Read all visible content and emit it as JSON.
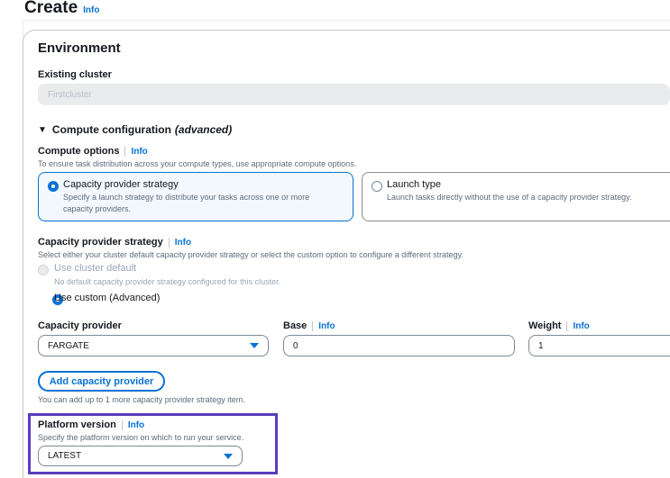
{
  "header": {
    "title": "Create",
    "info": "Info"
  },
  "environment": {
    "heading": "Environment",
    "existing_cluster_label": "Existing cluster",
    "existing_cluster_value": "Firstcluster"
  },
  "compute": {
    "expander_label": "Compute configuration",
    "expander_suffix": "(advanced)",
    "options_label": "Compute options",
    "options_info": "Info",
    "options_desc": "To ensure task distribution across your compute types, use appropriate compute options.",
    "tile_capacity_title": "Capacity provider strategy",
    "tile_capacity_desc": "Specify a launch strategy to distribute your tasks across one or more capacity providers.",
    "tile_launch_title": "Launch type",
    "tile_launch_desc": "Launch tasks directly without the use of a capacity provider strategy."
  },
  "strategy": {
    "label": "Capacity provider strategy",
    "info": "Info",
    "desc": "Select either your cluster default capacity provider strategy or select the custom option to configure a different strategy.",
    "default_label": "Use cluster default",
    "default_desc": "No default capacity provider strategy configured for this cluster.",
    "custom_label": "Use custom (Advanced)"
  },
  "provider_row": {
    "provider_label": "Capacity provider",
    "provider_value": "FARGATE",
    "base_label": "Base",
    "base_info": "Info",
    "base_value": "0",
    "weight_label": "Weight",
    "weight_info": "Info",
    "weight_value": "1"
  },
  "add_provider": {
    "button_label": "Add capacity provider",
    "hint": "You can add up to 1 more capacity provider strategy item."
  },
  "platform": {
    "label": "Platform version",
    "info": "Info",
    "desc": "Specify the platform version on which to run your service.",
    "value": "LATEST"
  },
  "colors": {
    "accent": "#0972d3",
    "highlight": "#5b3bbd"
  }
}
